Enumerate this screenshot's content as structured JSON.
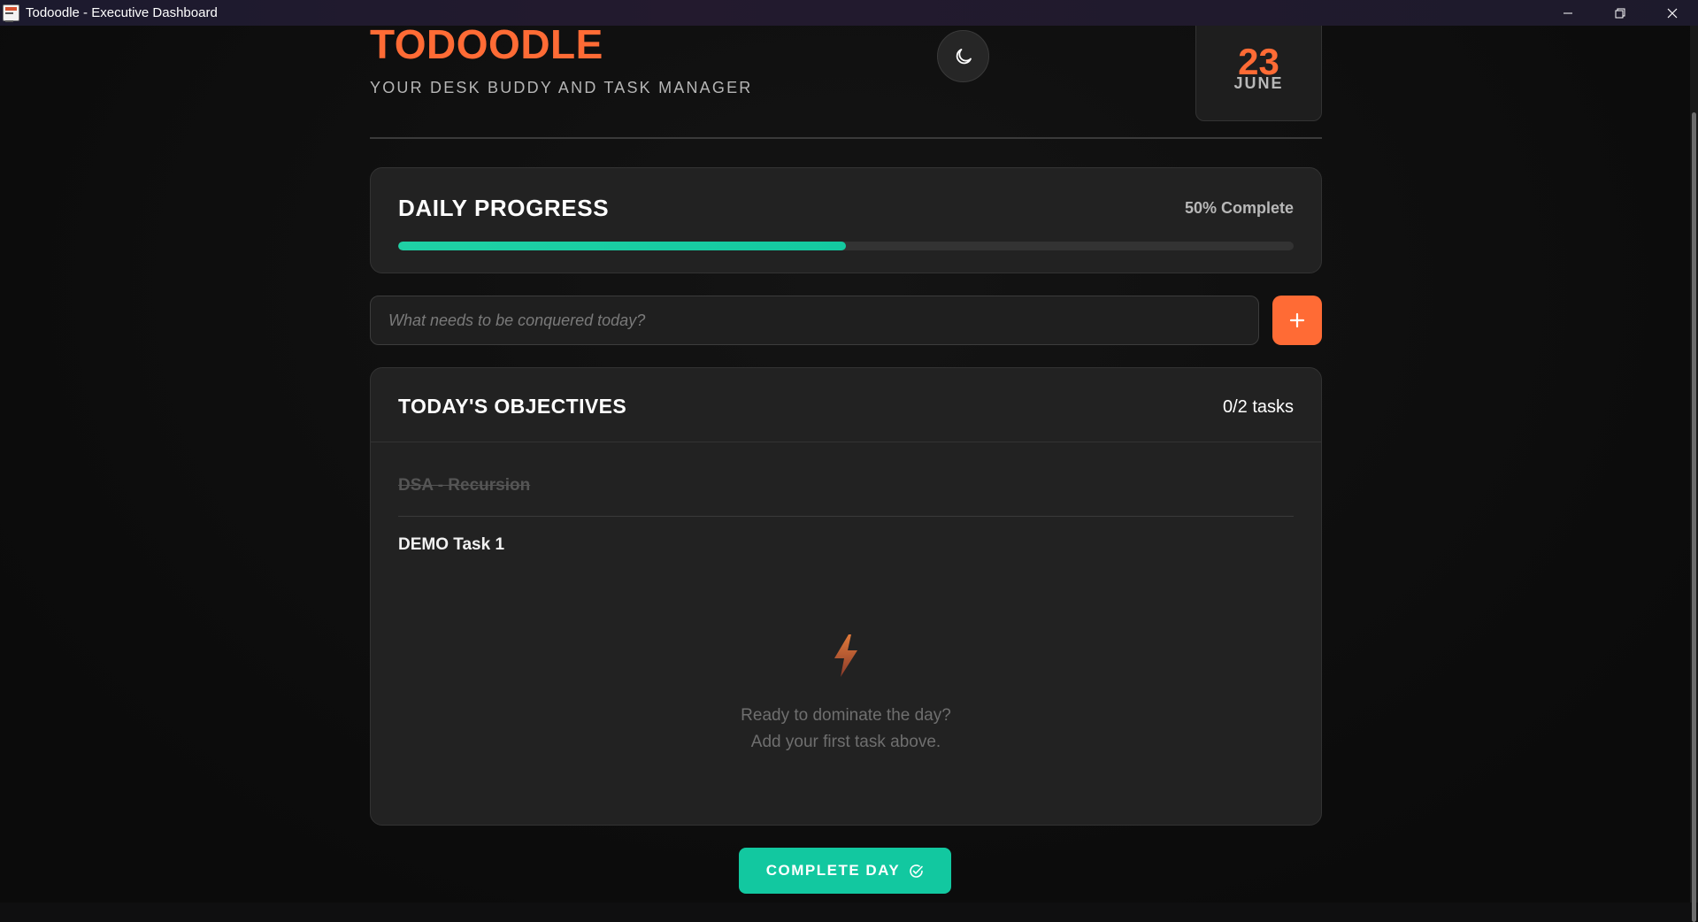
{
  "window": {
    "title": "Todoodle - Executive Dashboard",
    "controls": [
      "minimize",
      "restore",
      "close"
    ]
  },
  "header": {
    "brand": "TODOODLE",
    "tagline": "YOUR DESK BUDDY AND TASK MANAGER",
    "theme_toggle_icon": "moon-icon",
    "date": {
      "day": "23",
      "month": "JUNE"
    }
  },
  "progress": {
    "title": "DAILY PROGRESS",
    "percent_label": "50% Complete",
    "percent": 50
  },
  "new_task": {
    "placeholder": "What needs to be conquered today?",
    "value": "",
    "add_icon": "plus-icon"
  },
  "objectives": {
    "title": "TODAY'S OBJECTIVES",
    "count_label": "0/2 tasks",
    "tasks": [
      {
        "label": "DSA - Recursion",
        "completed": true
      },
      {
        "label": "DEMO Task 1",
        "completed": false
      }
    ],
    "empty_icon": "lightning-bolt-icon",
    "empty_line1": "Ready to dominate the day?",
    "empty_line2": "Add your first task above."
  },
  "footer": {
    "complete_label": "COMPLETE DAY",
    "complete_icon": "check-circle-icon"
  },
  "colors": {
    "accent": "#ff6b35",
    "success": "#12c8a0",
    "background": "#0f0f10",
    "card": "#222222"
  }
}
